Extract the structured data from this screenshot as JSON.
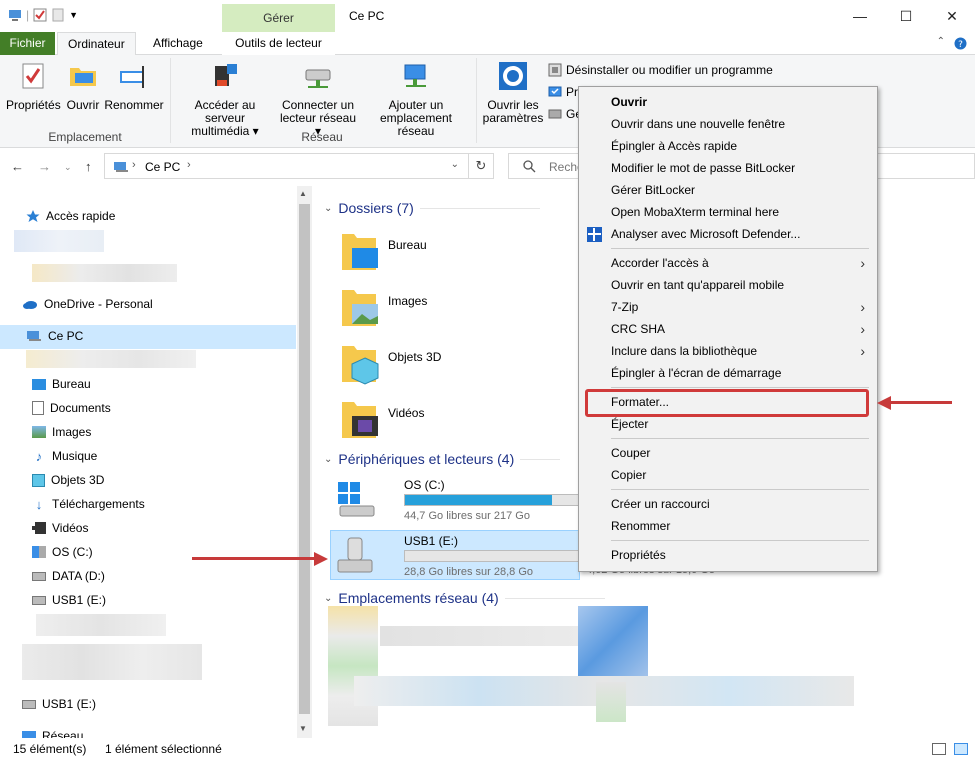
{
  "window": {
    "title": "Ce PC",
    "contextual_tab_group": "Gérer",
    "minimize": "—",
    "maximize": "☐",
    "close": "✕"
  },
  "ribbon_tabs": {
    "fichier": "Fichier",
    "ordinateur": "Ordinateur",
    "affichage": "Affichage",
    "outils": "Outils de lecteur"
  },
  "ribbon": {
    "emplacement": {
      "label": "Emplacement",
      "proprietes": "Propriétés",
      "ouvrir": "Ouvrir",
      "renommer": "Renommer"
    },
    "reseau": {
      "label": "Réseau",
      "acceder_l1": "Accéder au serveur",
      "acceder_l2": "multimédia ▾",
      "connecter_l1": "Connecter un",
      "connecter_l2": "lecteur réseau ▾",
      "ajouter_l1": "Ajouter un",
      "ajouter_l2": "emplacement réseau"
    },
    "systeme": {
      "ouvrir_params_l1": "Ouvrir les",
      "ouvrir_params_l2": "paramètres",
      "desinstaller": "Désinstaller ou modifier un programme",
      "pr": "Pr",
      "ge": "Gé"
    }
  },
  "address": {
    "path": "Ce PC",
    "search_placeholder": "Reche"
  },
  "sidebar": {
    "acces_rapide": "Accès rapide",
    "onedrive": "OneDrive - Personal",
    "ce_pc": "Ce PC",
    "items": [
      "Bureau",
      "Documents",
      "Images",
      "Musique",
      "Objets 3D",
      "Téléchargements",
      "Vidéos",
      "OS (C:)",
      "DATA (D:)",
      "USB1 (E:)"
    ],
    "usb_bottom": "USB1 (E:)",
    "reseau": "Réseau"
  },
  "main": {
    "dossiers_header": "Dossiers (7)",
    "folders": [
      "Bureau",
      "Images",
      "Objets 3D",
      "Vidéos"
    ],
    "peripheriques_header": "Périphériques et lecteurs (4)",
    "drives": [
      {
        "name": "OS (C:)",
        "free": "44,7 Go libres sur 217 Go",
        "used_fraction": 0.79
      },
      {
        "name": "USB1 (E:)",
        "free": "28,8 Go libres sur 28,8 Go",
        "used_fraction": 0.0
      }
    ],
    "hidden_drive_free": "4,62 Go libres sur 15,0 Go",
    "emplacements_header": "Emplacements réseau (4)"
  },
  "context_menu": {
    "ouvrir": "Ouvrir",
    "ouvrir_nouvelle": "Ouvrir dans une nouvelle fenêtre",
    "epingler_acces": "Épingler à Accès rapide",
    "modifier_bitlocker": "Modifier le mot de passe BitLocker",
    "gerer_bitlocker": "Gérer BitLocker",
    "mobaxterm": "Open MobaXterm terminal here",
    "defender": "Analyser avec Microsoft Defender...",
    "accorder": "Accorder l'accès à",
    "ouvrir_mobile": "Ouvrir en tant qu'appareil mobile",
    "zip": "7-Zip",
    "crc": "CRC SHA",
    "inclure": "Inclure dans la bibliothèque",
    "epingler_demarrage": "Épingler à l'écran de démarrage",
    "formater": "Formater...",
    "ejecter": "Éjecter",
    "couper": "Couper",
    "copier": "Copier",
    "creer_raccourci": "Créer un raccourci",
    "renommer": "Renommer",
    "proprietes": "Propriétés"
  },
  "status": {
    "count": "15 élément(s)",
    "selected": "1 élément sélectionné"
  },
  "colors": {
    "accent": "#26a0da",
    "selection": "#cce8ff",
    "fichier_tab": "#437e27",
    "annotation": "#d03a3a"
  }
}
